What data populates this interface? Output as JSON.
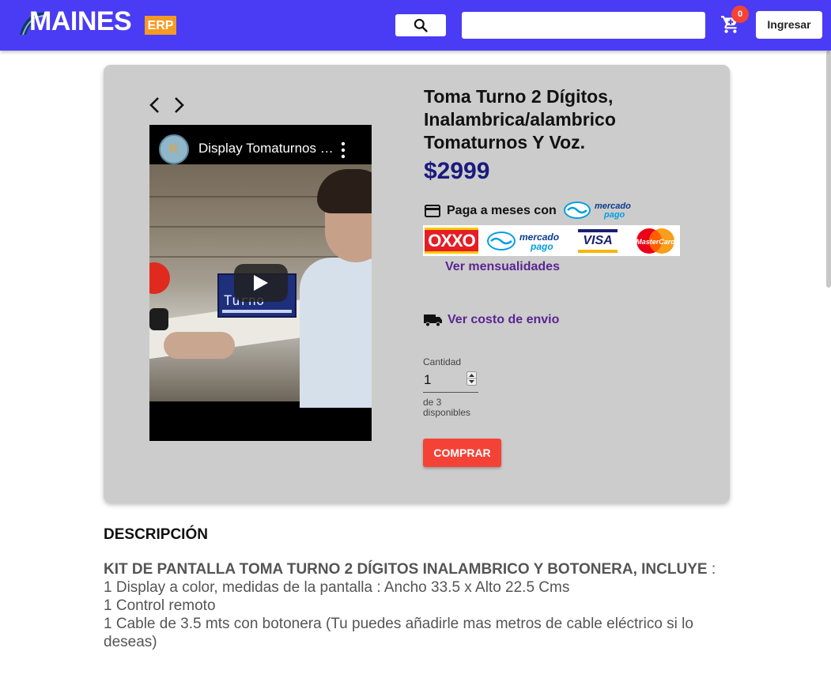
{
  "header": {
    "logo_text": "MAINES",
    "logo_suffix": "ERP",
    "search_icon": "search-icon",
    "search_value": "",
    "cart_icon": "shopping-cart-icon",
    "cart_count": "0",
    "login_label": "Ingresar",
    "colors": {
      "appbar": "#4a3cf4",
      "badge": "#f44336"
    }
  },
  "product": {
    "nav_prev_icon": "chevron-left-icon",
    "nav_next_icon": "chevron-right-icon",
    "video": {
      "channel_avatar": "K",
      "title": "Display Tomaturnos Inalambrico",
      "menu_icon": "more-vert-icon",
      "play_icon": "play-icon",
      "display_text": "Turno"
    },
    "title": "Toma Turno 2 Dígitos, Inalambrica/alambrico Tomaturnos Y Voz.",
    "price": "$2999",
    "payment": {
      "card_icon": "credit-card-icon",
      "label": "Paga a meses con",
      "mp_logo_top": "mercado",
      "mp_logo_bottom": "pago",
      "methods": [
        "OXXO",
        "mercado pago",
        "VISA",
        "MasterCard"
      ],
      "ver_mensualidades": "Ver mensualidades"
    },
    "shipping": {
      "truck_icon": "truck-icon",
      "label": "Ver costo de envio"
    },
    "quantity": {
      "label": "Cantidad",
      "value": "1",
      "available": "de 3 disponibles"
    },
    "buy_label": "COMPRAR",
    "colors": {
      "price": "#1a1a7e",
      "link": "#5b2590",
      "buy": "#f44336",
      "card_bg": "#cccccc"
    }
  },
  "description": {
    "heading": "DESCRIPCIÓN",
    "lead_bold": "KIT DE PANTALLA TOMA TURNO 2 DÍGITOS INALAMBRICO Y BOTONERA, INCLUYE",
    "lead_rest": " :",
    "lines": [
      "1 Display a color, medidas de la pantalla : Ancho 33.5 x Alto 22.5 Cms",
      "1 Control remoto",
      "1 Cable de 3.5 mts con botonera (Tu puedes añadirle mas metros de cable eléctrico si lo deseas)"
    ]
  }
}
